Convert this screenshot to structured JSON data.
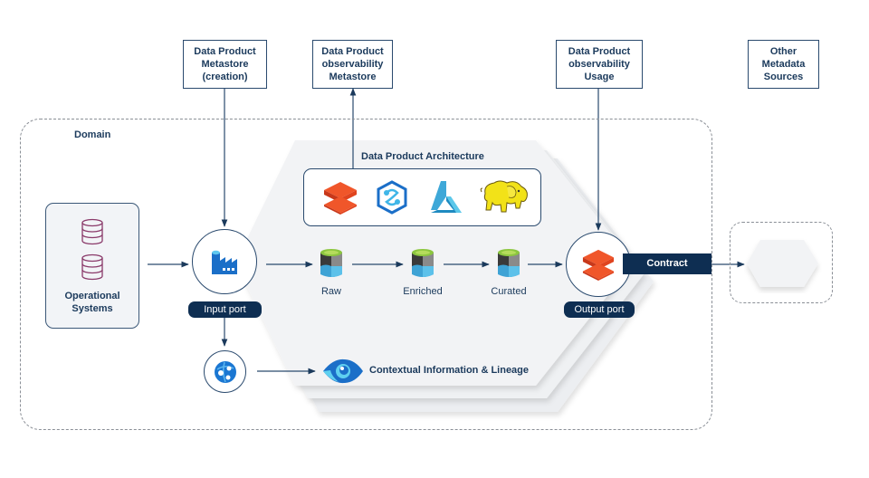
{
  "metadata_boxes": [
    {
      "id": "metastore-creation",
      "text": "Data Product\nMetastore\n(creation)"
    },
    {
      "id": "observability-metastore",
      "text": "Data Product\nobservability\nMetastore"
    },
    {
      "id": "observability-usage",
      "text": "Data Product\nobservability\nUsage"
    },
    {
      "id": "other-metadata",
      "text": "Other\nMetadata\nSources"
    }
  ],
  "domain": {
    "label": "Domain"
  },
  "operational_systems": {
    "label": "Operational\nSystems",
    "icons": [
      "database-icon",
      "database-icon"
    ]
  },
  "input_port": {
    "label": "Input port",
    "icon": "data-factory-icon"
  },
  "catalog_node": {
    "icon": "purview-catalog-icon"
  },
  "architecture": {
    "title": "Data Product Architecture",
    "icons": [
      "databricks-icon",
      "synapse-icon",
      "machine-learning-icon",
      "hadoop-elephant-icon"
    ]
  },
  "stages": [
    {
      "label": "Raw",
      "icon": "data-lake-storage-icon"
    },
    {
      "label": "Enriched",
      "icon": "data-lake-storage-icon"
    },
    {
      "label": "Curated",
      "icon": "data-lake-storage-icon"
    }
  ],
  "lineage": {
    "label": "Contextual Information & Lineage",
    "icon": "eye-icon"
  },
  "output_port": {
    "label": "Output port",
    "icon": "databricks-icon"
  },
  "contract": {
    "label": "Contract"
  },
  "colors": {
    "navy": "#0e2e52",
    "line": "#2a4a6e",
    "databricks": "#ef4a23",
    "azure_blue": "#1b77d2",
    "hex_fill": "#f2f3f5",
    "db_icon": "#8a3a6a"
  }
}
